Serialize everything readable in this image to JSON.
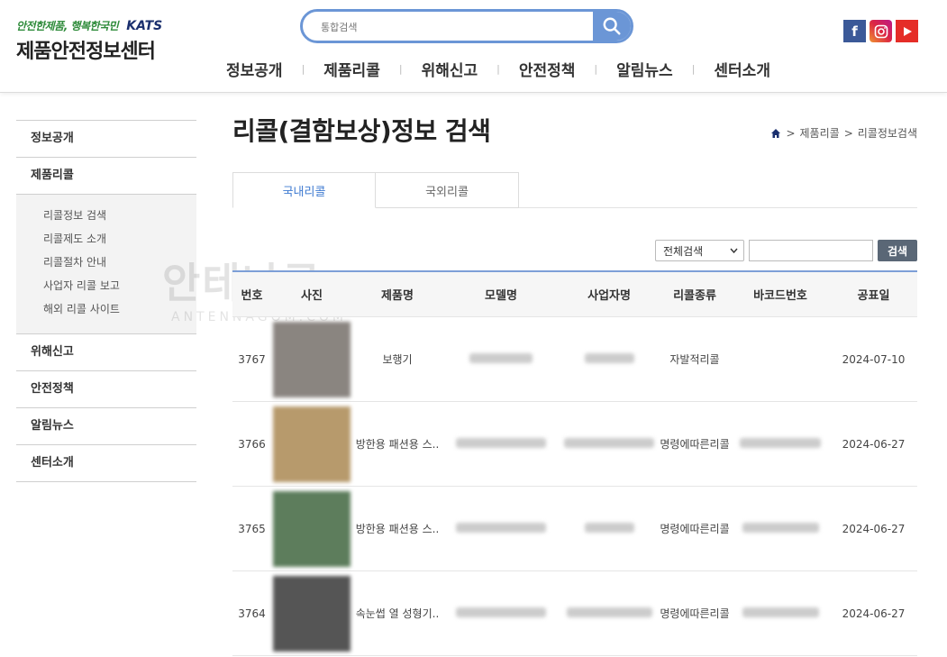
{
  "header": {
    "slogan": "안전한제품, 행복한국민",
    "brand": "KATS",
    "site_title": "제품안전정보센터",
    "search_placeholder": "통합검색",
    "gnb": [
      "정보공개",
      "제품리콜",
      "위해신고",
      "안전정책",
      "알림뉴스",
      "센터소개"
    ],
    "social": [
      "facebook-icon",
      "instagram-icon",
      "youtube-icon"
    ]
  },
  "sidebar": {
    "items": [
      "정보공개",
      "제품리콜",
      "위해신고",
      "안전정책",
      "알림뉴스",
      "센터소개"
    ],
    "sub_items": [
      "리콜정보 검색",
      "리콜제도 소개",
      "리콜절차 안내",
      "사업자 리콜 보고",
      "해외 리콜 사이트"
    ]
  },
  "main": {
    "title": "리콜(결함보상)정보 검색",
    "breadcrumb": [
      "제품리콜",
      "리콜정보검색"
    ],
    "tabs": [
      "국내리콜",
      "국외리콜"
    ],
    "filter": {
      "select_value": "전체검색",
      "button_label": "검색"
    }
  },
  "table": {
    "headers": [
      "번호",
      "사진",
      "제품명",
      "모델명",
      "사업자명",
      "리콜종류",
      "바코드번호",
      "공표일"
    ],
    "rows": [
      {
        "no": "3767",
        "product": "보행기",
        "recall_type": "자발적리콜",
        "date": "2024-07-10",
        "thumb_color": "#8a8580"
      },
      {
        "no": "3766",
        "product": "방한용 패션용 스..",
        "recall_type": "명령에따른리콜",
        "date": "2024-06-27",
        "thumb_color": "#b79a6c"
      },
      {
        "no": "3765",
        "product": "방한용 패션용 스..",
        "recall_type": "명령에따른리콜",
        "date": "2024-06-27",
        "thumb_color": "#5d7d5c"
      },
      {
        "no": "3764",
        "product": "속눈썹 열 성형기..",
        "recall_type": "명령에따른리콜",
        "date": "2024-06-27",
        "thumb_color": "#555555"
      }
    ]
  },
  "watermark": {
    "line1": "안테나곰",
    "line2": "ANTENNAGOM.COM"
  }
}
